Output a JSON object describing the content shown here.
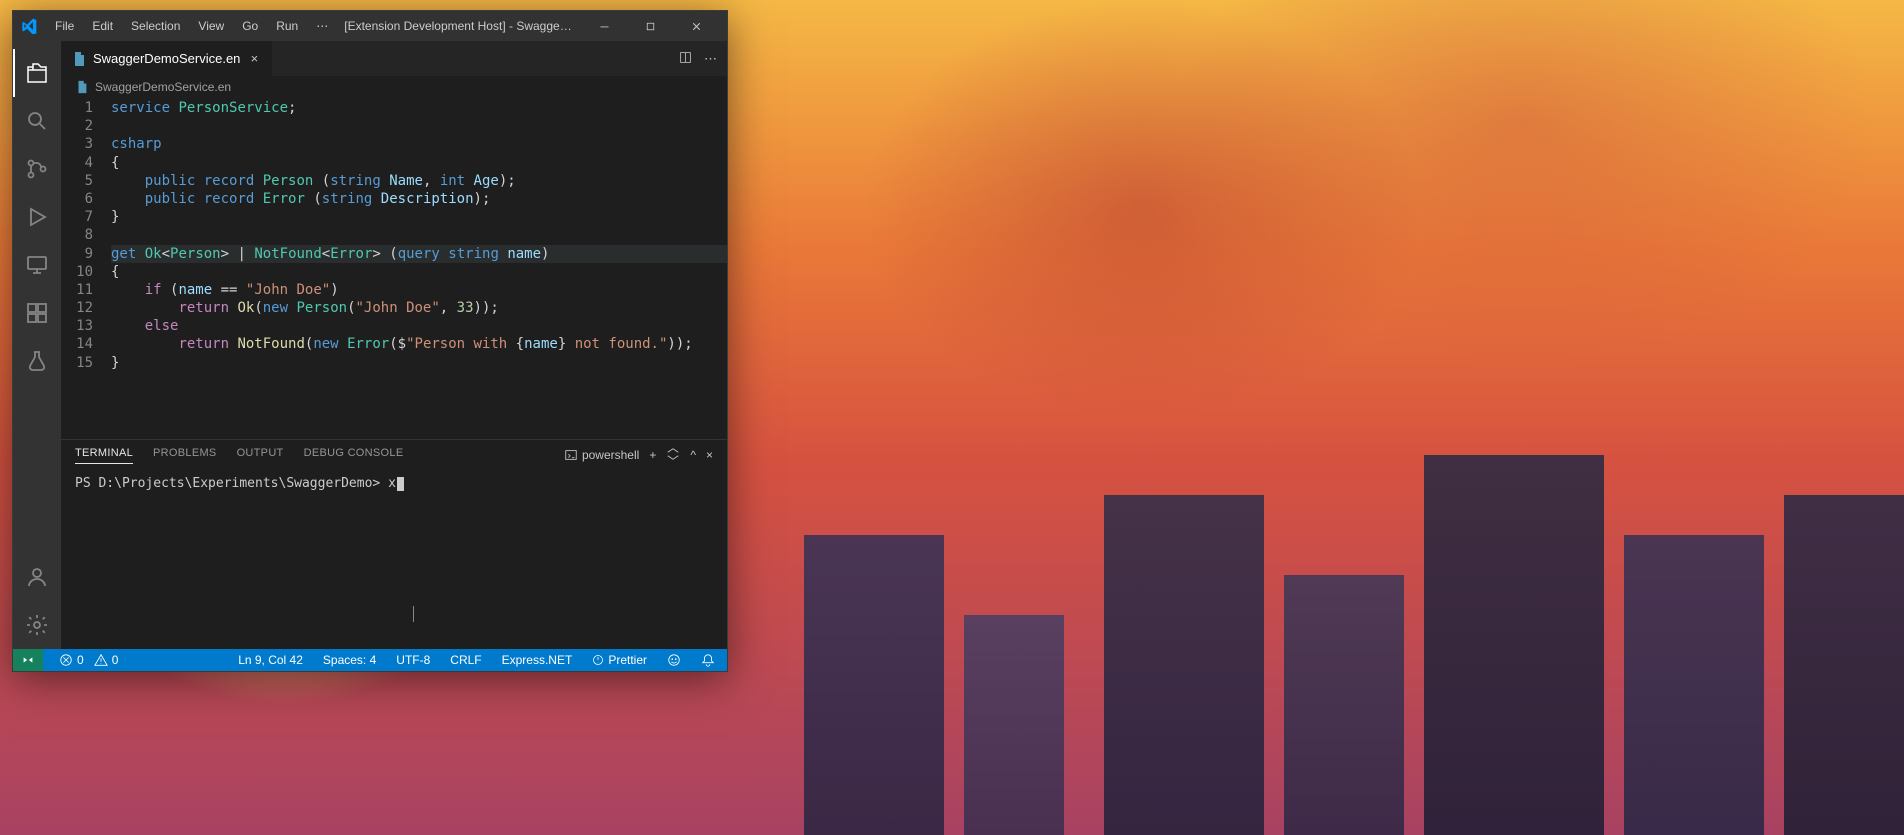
{
  "window": {
    "title": "[Extension Development Host] - SwaggerDemoService.en - SwaggerDe...",
    "menu": [
      "File",
      "Edit",
      "Selection",
      "View",
      "Go",
      "Run",
      "⋯"
    ]
  },
  "tab": {
    "filename": "SwaggerDemoService.en"
  },
  "breadcrumb": {
    "file": "SwaggerDemoService.en"
  },
  "code": {
    "line_numbers": [
      "1",
      "2",
      "3",
      "4",
      "5",
      "6",
      "7",
      "8",
      "9",
      "10",
      "11",
      "12",
      "13",
      "14",
      "15"
    ]
  },
  "panel": {
    "tabs": [
      "TERMINAL",
      "PROBLEMS",
      "OUTPUT",
      "DEBUG CONSOLE"
    ],
    "active_tab": "TERMINAL",
    "shell_label": "powershell",
    "prompt": "PS D:\\Projects\\Experiments\\SwaggerDemo> ",
    "input": "x"
  },
  "status": {
    "errors": "0",
    "warnings": "0",
    "cursor": "Ln 9, Col 42",
    "spaces": "Spaces: 4",
    "encoding": "UTF-8",
    "eol": "CRLF",
    "language": "Express.NET",
    "prettier": "Prettier"
  }
}
